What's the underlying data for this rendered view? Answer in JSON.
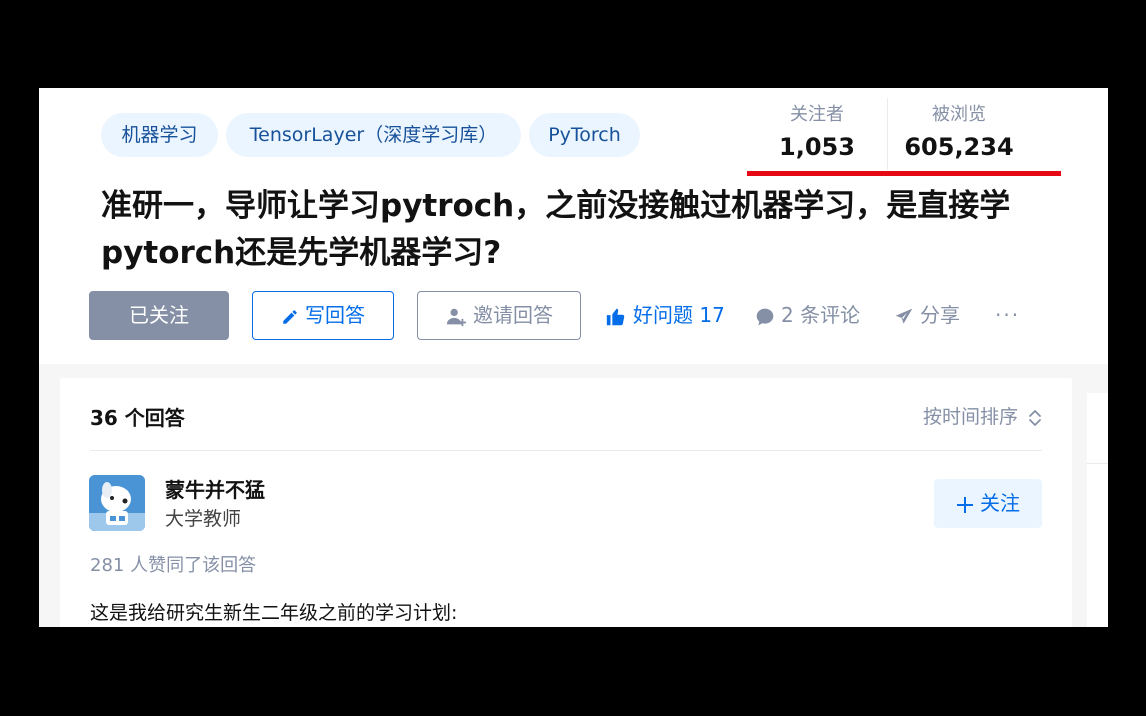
{
  "topics": [
    "机器学习",
    "TensorLayer（深度学习库）",
    "PyTorch"
  ],
  "stats": {
    "followers_label": "关注者",
    "followers_value": "1,053",
    "views_label": "被浏览",
    "views_value": "605,234"
  },
  "question": {
    "title": "准研一，导师让学习pytroch，之前没接触过机器学习，是直接学pytorch还是先学机器学习?"
  },
  "actions": {
    "followed": "已关注",
    "write_answer": "写回答",
    "invite": "邀请回答",
    "good_question": "好问题 17",
    "comments": "2 条评论",
    "share": "分享",
    "more": "···"
  },
  "answers": {
    "count_label": "36 个回答",
    "sort_label": "按时间排序"
  },
  "answer": {
    "author_name": "蒙牛并不猛",
    "author_headline": "大学教师",
    "follow_label": "关注",
    "votes": "281 人赞同了该回答",
    "text": "这是我给研究生新生二年级之前的学习计划:"
  },
  "colors": {
    "accent": "#056de8",
    "topic_bg": "#ebf5ff",
    "muted": "#8590a6",
    "highlight": "#e50914"
  }
}
